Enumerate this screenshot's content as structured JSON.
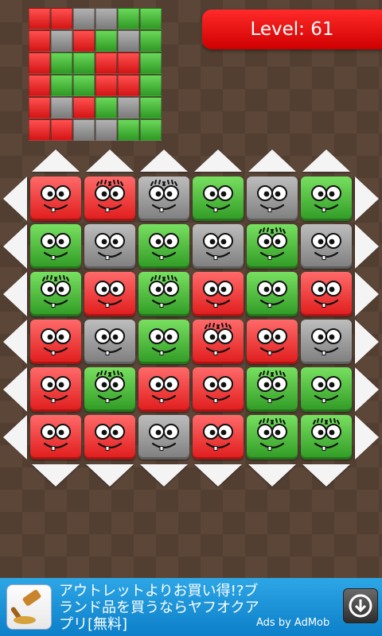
{
  "level_label": "Level: 61",
  "target_pattern": [
    [
      "red",
      "red",
      "gray",
      "gray",
      "green",
      "green"
    ],
    [
      "red",
      "gray",
      "red",
      "green",
      "gray",
      "green"
    ],
    [
      "red",
      "green",
      "green",
      "red",
      "red",
      "green"
    ],
    [
      "red",
      "green",
      "green",
      "red",
      "red",
      "green"
    ],
    [
      "red",
      "gray",
      "red",
      "green",
      "gray",
      "green"
    ],
    [
      "red",
      "red",
      "gray",
      "gray",
      "green",
      "green"
    ]
  ],
  "board": [
    [
      {
        "color": "red",
        "lashes": false
      },
      {
        "color": "red",
        "lashes": true
      },
      {
        "color": "gray",
        "lashes": true
      },
      {
        "color": "green",
        "lashes": false
      },
      {
        "color": "gray",
        "lashes": false
      },
      {
        "color": "green",
        "lashes": false
      }
    ],
    [
      {
        "color": "green",
        "lashes": false
      },
      {
        "color": "gray",
        "lashes": false
      },
      {
        "color": "green",
        "lashes": false
      },
      {
        "color": "gray",
        "lashes": false
      },
      {
        "color": "green",
        "lashes": true
      },
      {
        "color": "gray",
        "lashes": false
      }
    ],
    [
      {
        "color": "green",
        "lashes": true
      },
      {
        "color": "red",
        "lashes": false
      },
      {
        "color": "green",
        "lashes": true
      },
      {
        "color": "red",
        "lashes": false
      },
      {
        "color": "green",
        "lashes": false
      },
      {
        "color": "red",
        "lashes": false
      }
    ],
    [
      {
        "color": "red",
        "lashes": false
      },
      {
        "color": "gray",
        "lashes": false
      },
      {
        "color": "green",
        "lashes": false
      },
      {
        "color": "red",
        "lashes": true
      },
      {
        "color": "red",
        "lashes": false
      },
      {
        "color": "gray",
        "lashes": false
      }
    ],
    [
      {
        "color": "red",
        "lashes": false
      },
      {
        "color": "green",
        "lashes": true
      },
      {
        "color": "red",
        "lashes": false
      },
      {
        "color": "red",
        "lashes": false
      },
      {
        "color": "green",
        "lashes": true
      },
      {
        "color": "green",
        "lashes": false
      }
    ],
    [
      {
        "color": "red",
        "lashes": false
      },
      {
        "color": "red",
        "lashes": false
      },
      {
        "color": "gray",
        "lashes": false
      },
      {
        "color": "red",
        "lashes": false
      },
      {
        "color": "green",
        "lashes": true
      },
      {
        "color": "green",
        "lashes": true
      }
    ]
  ],
  "ad": {
    "text": "アウトレットよりお買い得!?ブ\nランド品を買うならヤフオクア\nプリ[無料]",
    "attribution": "Ads by AdMob",
    "icon": "auction-hammer-icon",
    "download_icon": "download-icon"
  }
}
